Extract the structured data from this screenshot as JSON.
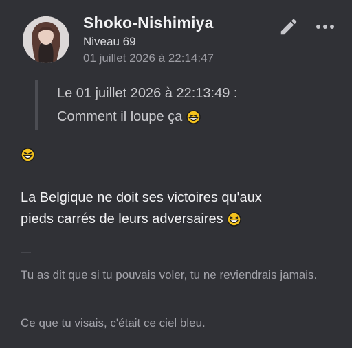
{
  "post": {
    "username": "Shoko-Nishimiya",
    "level": "Niveau 69",
    "timestamp": "01 juillet 2026 à 22:14:47"
  },
  "quote": {
    "header": "Le 01 juillet 2026 à 22:13:49 :",
    "text": "Comment il loupe ça"
  },
  "body": {
    "line1": "La Belgique ne doit ses victoires qu'aux",
    "line2": "pieds carrés de leurs adversaires"
  },
  "signature": {
    "separator": "—",
    "line1": "Tu as dit que si tu pouvais voler, tu ne reviendrais jamais.",
    "line2": "Ce que tu visais, c'était ce ciel bleu."
  },
  "icons": {
    "edit": "pencil-icon",
    "more": "more-dots-icon",
    "emoji": "laughing-emoji-icon"
  },
  "colors": {
    "background": "#303136",
    "username": "#f2f2f4",
    "timestamp": "#9c9ca3",
    "quote_bar": "#4c4d53"
  }
}
